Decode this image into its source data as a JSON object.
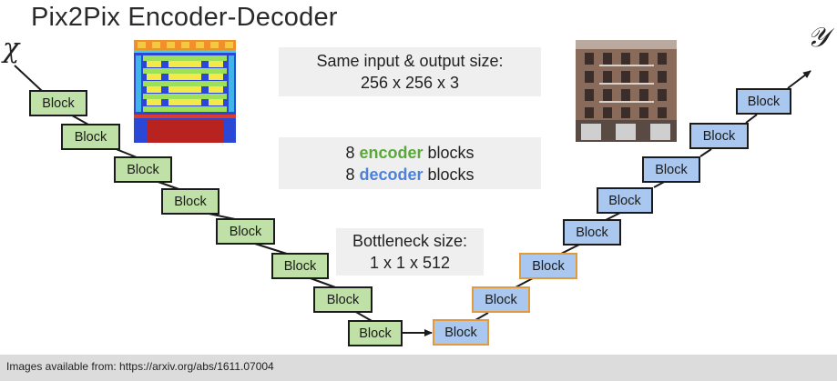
{
  "title": "Pix2Pix Encoder-Decoder",
  "labels": {
    "input": "χ",
    "output": "𝒴"
  },
  "encoder_blocks": [
    "Block",
    "Block",
    "Block",
    "Block",
    "Block",
    "Block",
    "Block",
    "Block"
  ],
  "decoder_blocks": [
    "Block",
    "Block",
    "Block",
    "Block",
    "Block",
    "Block",
    "Block",
    "Block"
  ],
  "notes": {
    "size": {
      "line1": "Same input & output size:",
      "line2": "256 x 256 x 3"
    },
    "blocks": {
      "line1_num": "8",
      "line1_word": "encoder",
      "line1_tail": "blocks",
      "line2_num": "8",
      "line2_word": "decoder",
      "line2_tail": "blocks"
    },
    "bottleneck": {
      "line1": "Bottleneck size:",
      "line2": "1 x 1 x 512"
    }
  },
  "footer": "Images available from: https://arxiv.org/abs/1611.07004",
  "colors": {
    "encoder_fill": "#bfe0a6",
    "decoder_fill": "#a9c7ef",
    "bottleneck_border": "#e29a3c",
    "encoder_word": "#5aa83a",
    "decoder_word": "#4e82d8"
  },
  "images": {
    "left": "facade-label-map",
    "right": "building-facade-photo"
  }
}
